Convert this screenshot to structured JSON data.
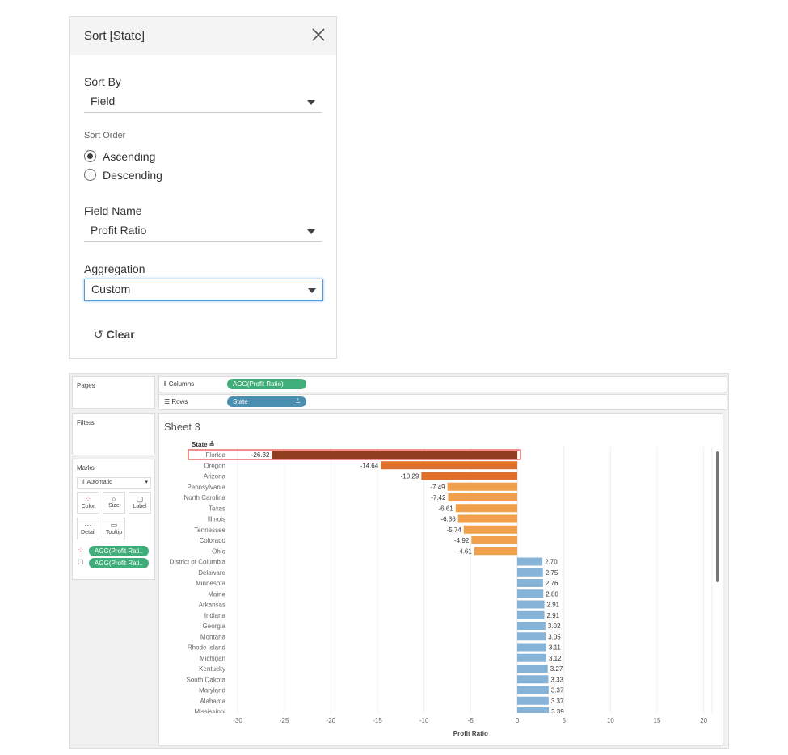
{
  "dialog": {
    "title": "Sort [State]",
    "sort_by_label": "Sort By",
    "sort_by_value": "Field",
    "sort_order_label": "Sort Order",
    "ascending": "Ascending",
    "descending": "Descending",
    "selected_order": "Ascending",
    "field_name_label": "Field Name",
    "field_name_value": "Profit Ratio",
    "aggregation_label": "Aggregation",
    "aggregation_value": "Custom",
    "clear": "Clear"
  },
  "workspace": {
    "pages": "Pages",
    "filters": "Filters",
    "marks": "Marks",
    "mark_type": "Automatic",
    "mark_buttons": [
      "Color",
      "Size",
      "Label",
      "Detail",
      "Tooltip"
    ],
    "mark_pills": [
      "AGG(Profit Rati..",
      "AGG(Profit Rati.."
    ],
    "columns_label": "Columns",
    "columns_pill": "AGG(Profit Ratio)",
    "rows_label": "Rows",
    "rows_pill": "State",
    "sheet_title": "Sheet 3",
    "pill_green": "#3fae7a",
    "pill_blue": "#4a8fb0"
  },
  "chart_data": {
    "type": "bar",
    "orientation": "horizontal",
    "row_header": "State",
    "xlabel": "Profit Ratio",
    "xlim": [
      -30,
      20
    ],
    "xticks": [
      -30,
      -25,
      -20,
      -15,
      -10,
      -5,
      0,
      5,
      10,
      15,
      20
    ],
    "highlighted": "Florida",
    "highlight_color": "#e8453c",
    "categories": [
      "Florida",
      "Oregon",
      "Arizona",
      "Pennsylvania",
      "North Carolina",
      "Texas",
      "Illinois",
      "Tennessee",
      "Colorado",
      "Ohio",
      "District of Columbia",
      "Delaware",
      "Minnesota",
      "Maine",
      "Arkansas",
      "Indiana",
      "Georgia",
      "Montana",
      "Rhode Island",
      "Michigan",
      "Kentucky",
      "South Dakota",
      "Maryland",
      "Alabama",
      "Mississippi"
    ],
    "values": [
      -26.32,
      -14.64,
      -10.29,
      -7.49,
      -7.42,
      -6.61,
      -6.36,
      -5.74,
      -4.92,
      -4.61,
      2.7,
      2.75,
      2.76,
      2.8,
      2.91,
      2.91,
      3.02,
      3.05,
      3.11,
      3.12,
      3.27,
      3.33,
      3.37,
      3.37,
      3.39
    ],
    "labels": [
      "-26.32",
      "-14.64",
      "-10.29",
      "-7.49",
      "-7.42",
      "-6.61",
      "-6.36",
      "-5.74",
      "-4.92",
      "-4.61",
      "2.70",
      "2.75",
      "2.76",
      "2.80",
      "2.91",
      "2.91",
      "3.02",
      "3.05",
      "3.11",
      "3.12",
      "3.27",
      "3.33",
      "3.37",
      "3.37",
      "3.39"
    ],
    "colors": {
      "darkest": "#8f3e1f",
      "dark": "#df6f2b",
      "light": "#f0a04c",
      "positive": "#86b4d9"
    }
  }
}
